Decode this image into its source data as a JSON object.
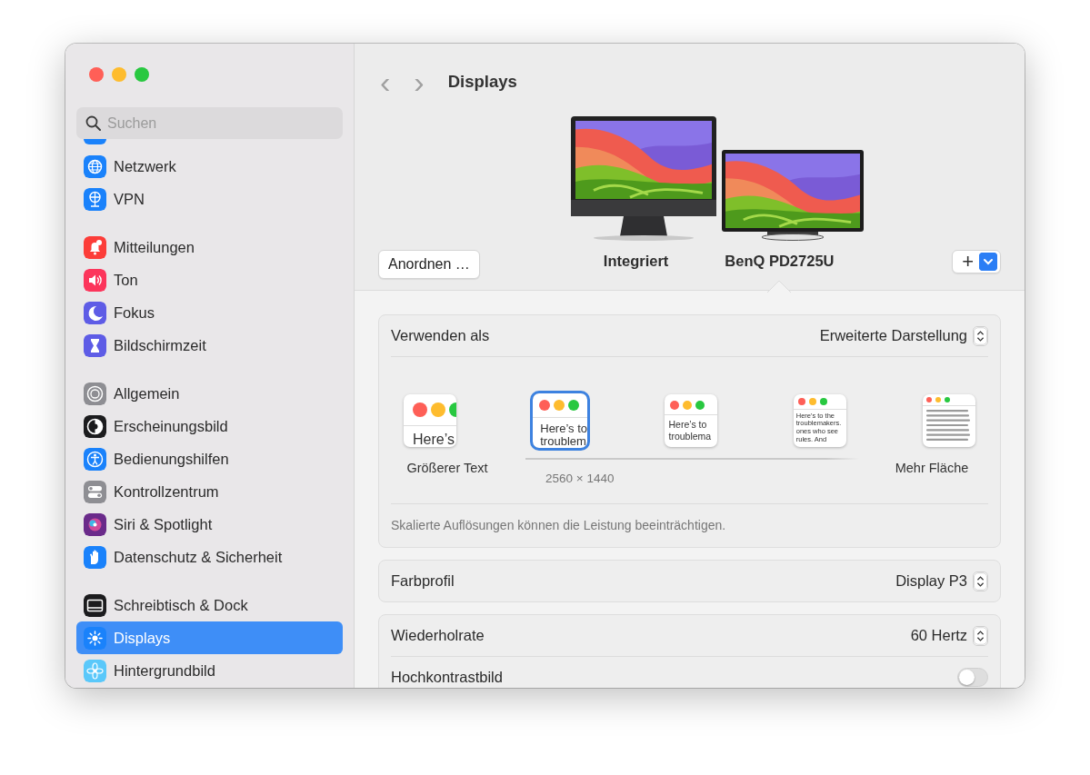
{
  "window": {
    "controls": [
      {
        "color": "#ff5f57"
      },
      {
        "color": "#febc2e"
      },
      {
        "color": "#28c840"
      }
    ]
  },
  "search": {
    "placeholder": "Suchen"
  },
  "sidebar": {
    "groups": [
      [
        {
          "label": "Netzwerk",
          "color": "#1a82fb",
          "selected": false
        },
        {
          "label": "VPN",
          "color": "#1a82fb",
          "selected": false
        }
      ],
      [
        {
          "label": "Mitteilungen",
          "color": "#fc3d39",
          "selected": false
        },
        {
          "label": "Ton",
          "color": "#fc355b",
          "selected": false
        },
        {
          "label": "Fokus",
          "color": "#5e5ce6",
          "selected": false
        },
        {
          "label": "Bildschirmzeit",
          "color": "#5e5ce6",
          "selected": false
        }
      ],
      [
        {
          "label": "Allgemein",
          "color": "#8e8e93",
          "selected": false
        },
        {
          "label": "Erscheinungsbild",
          "color": "#1c1c1e",
          "selected": false
        },
        {
          "label": "Bedienungshilfen",
          "color": "#1a82fb",
          "selected": false
        },
        {
          "label": "Kontrollzentrum",
          "color": "#8e8e93",
          "selected": false
        },
        {
          "label": "Siri & Spotlight",
          "color": "#6a2a8a",
          "selected": false
        },
        {
          "label": "Datenschutz & Sicherheit",
          "color": "#1a82fb",
          "selected": false
        }
      ],
      [
        {
          "label": "Schreibtisch & Dock",
          "color": "#1c1c1e",
          "selected": false
        },
        {
          "label": "Displays",
          "color": "#1a82fb",
          "selected": true
        },
        {
          "label": "Hintergrundbild",
          "color": "#5ac8fa",
          "selected": false
        }
      ]
    ]
  },
  "header": {
    "back": "‹",
    "forward": "›",
    "title": "Displays"
  },
  "displays": [
    {
      "kind": "imac",
      "label": "Integriert",
      "selected": false
    },
    {
      "kind": "monitor",
      "label": "BenQ PD2725U",
      "selected": true
    }
  ],
  "arrange_button": "Anordnen …",
  "add_button": {
    "label": "+"
  },
  "use_as": {
    "label": "Verwenden als",
    "value": "Erweiterte Darstellung"
  },
  "scaling": {
    "options": [
      {
        "lines": [
          "Here’s"
        ],
        "selected": false
      },
      {
        "lines": [
          "Here’s to",
          "troublem"
        ],
        "selected": true
      },
      {
        "lines": [
          "Here’s to",
          "troublema"
        ],
        "selected": false
      },
      {
        "lines": [
          "Here's to the",
          "troublemakers.",
          "ones who see",
          "rules. And"
        ],
        "selected": false
      },
      {
        "selected": false
      }
    ],
    "left_label": "Größerer Text",
    "right_label": "Mehr Fläche",
    "resolution": "2560 × 1440",
    "note": "Skalierte Auflösungen können die Leistung beeinträchtigen."
  },
  "color_profile": {
    "label": "Farbprofil",
    "value": "Display P3"
  },
  "refresh": {
    "label": "Wiederholrate",
    "value": "60 Hertz"
  },
  "high_contrast": {
    "label": "Hochkontrastbild",
    "on": false
  }
}
